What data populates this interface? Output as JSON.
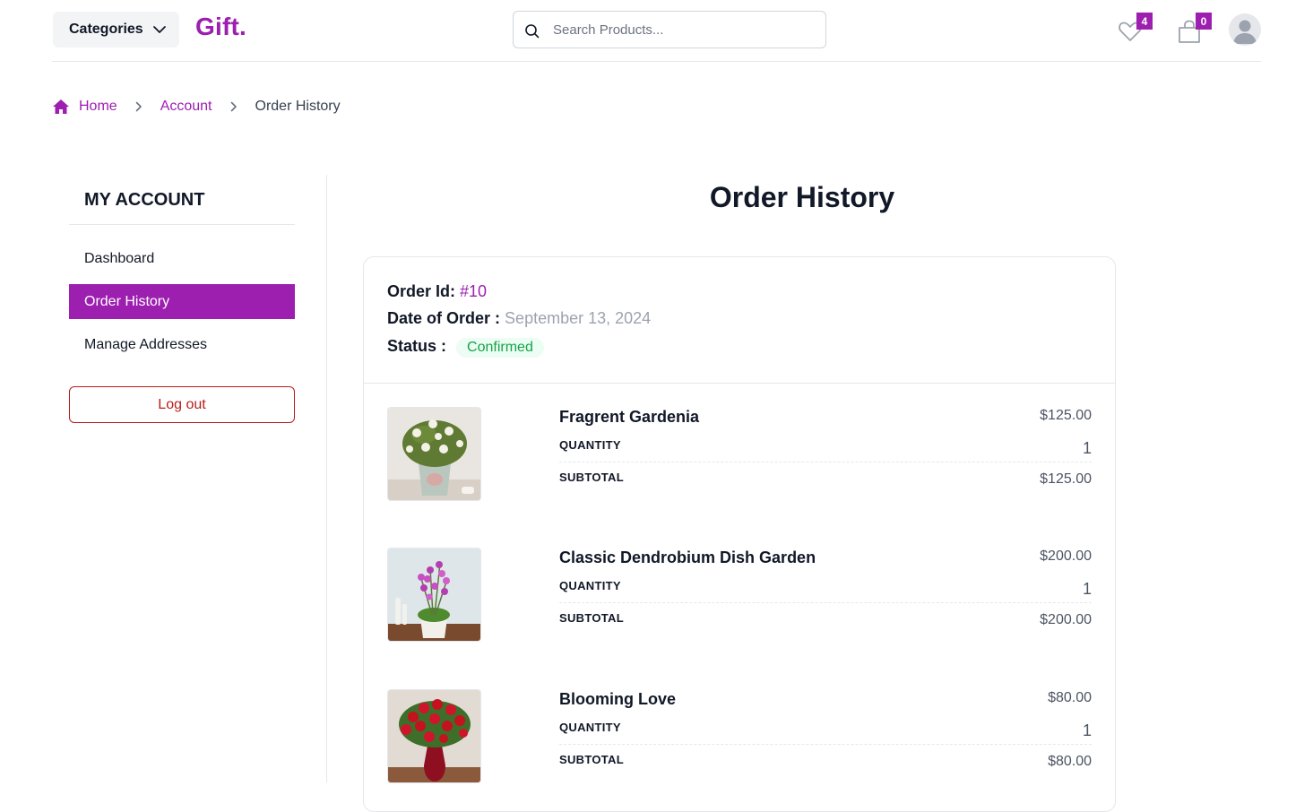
{
  "header": {
    "categories_label": "Categories",
    "logo": "Gift.",
    "search_placeholder": "Search Products...",
    "wishlist_count": "4",
    "cart_count": "0"
  },
  "breadcrumb": {
    "home": "Home",
    "account": "Account",
    "current": "Order History"
  },
  "sidebar": {
    "title": "MY ACCOUNT",
    "items": [
      {
        "label": "Dashboard",
        "active": false
      },
      {
        "label": "Order History",
        "active": true
      },
      {
        "label": "Manage Addresses",
        "active": false
      }
    ],
    "logout_label": "Log out"
  },
  "main": {
    "title": "Order History",
    "order": {
      "id_label": "Order Id:",
      "id_value": "#10",
      "date_label": "Date of Order :",
      "date_value": "September 13, 2024",
      "status_label": "Status :",
      "status_value": "Confirmed"
    },
    "items": [
      {
        "name": "Fragrent Gardenia",
        "price": "$125.00",
        "quantity_label": "QUANTITY",
        "quantity": "1",
        "subtotal_label": "SUBTOTAL",
        "subtotal": "$125.00"
      },
      {
        "name": "Classic Dendrobium Dish Garden",
        "price": "$200.00",
        "quantity_label": "QUANTITY",
        "quantity": "1",
        "subtotal_label": "SUBTOTAL",
        "subtotal": "$200.00"
      },
      {
        "name": "Blooming Love",
        "price": "$80.00",
        "quantity_label": "QUANTITY",
        "quantity": "1",
        "subtotal_label": "SUBTOTAL",
        "subtotal": "$80.00"
      }
    ]
  },
  "colors": {
    "brand": "#9c1fb0",
    "status_green": "#16a34a",
    "logout_red": "#b91c1c"
  }
}
